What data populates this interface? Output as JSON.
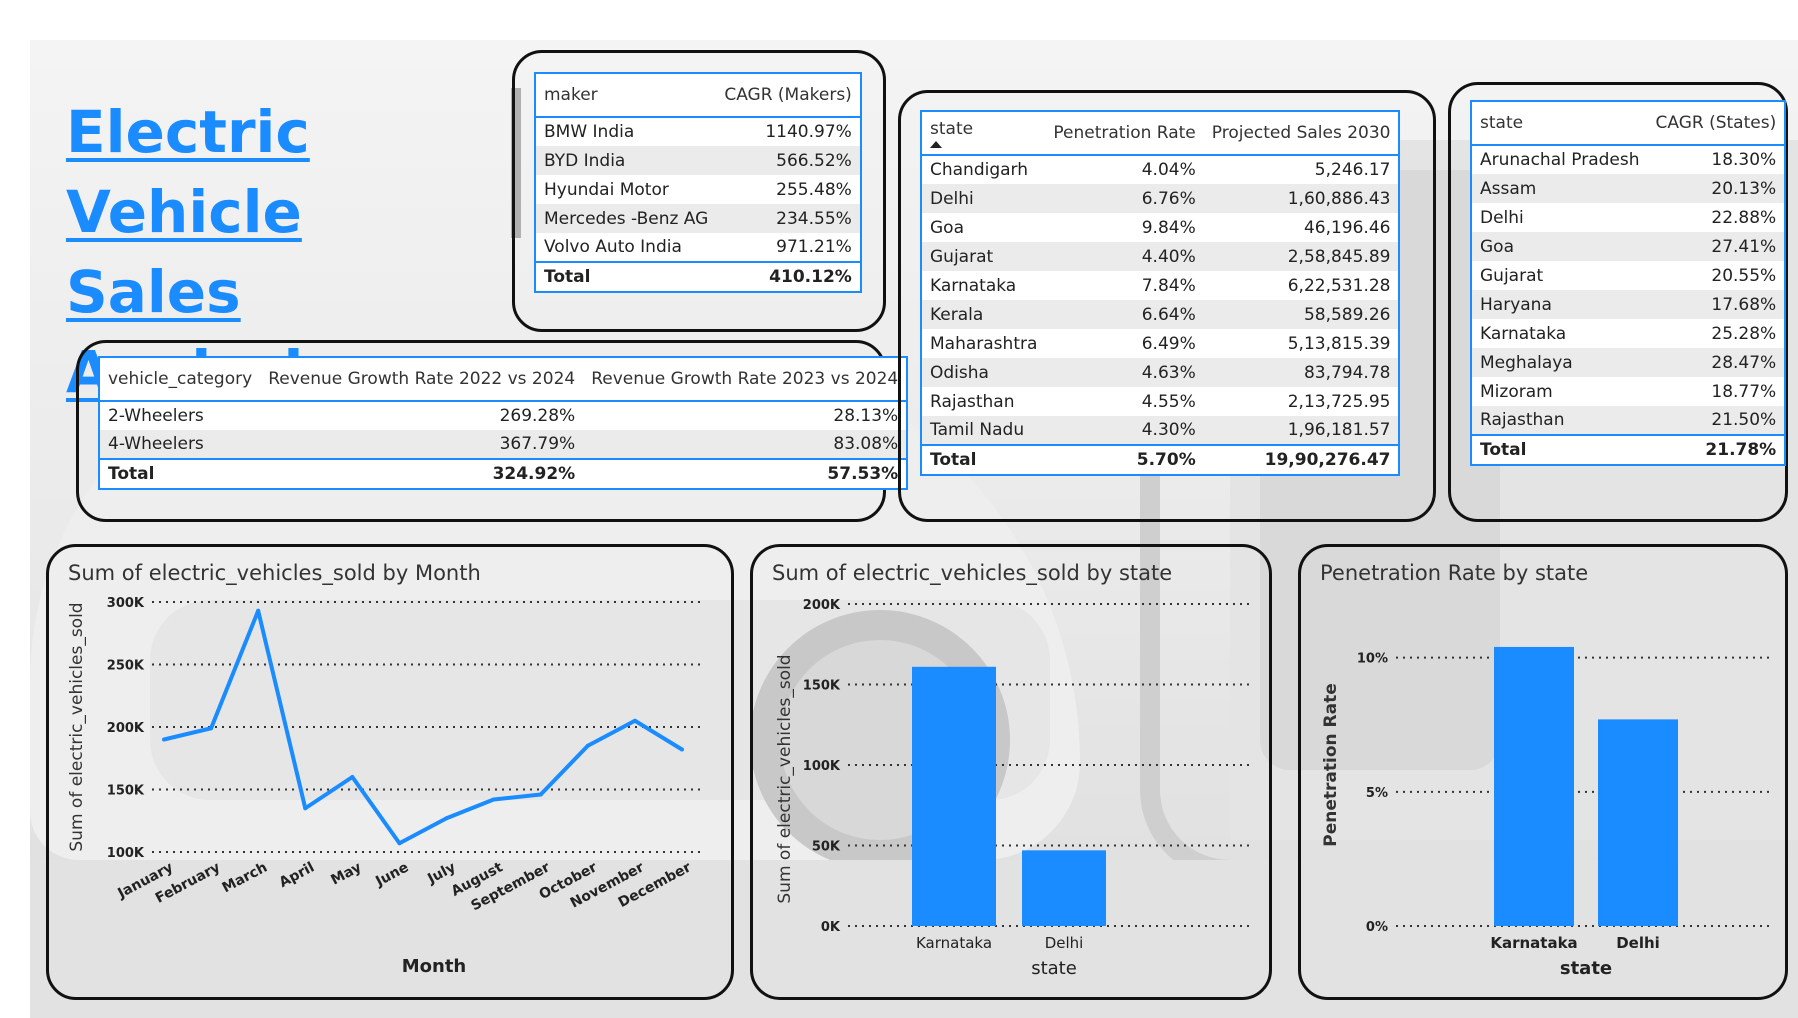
{
  "page": {
    "title_line1": "Electric Vehicle ",
    "title_line2": "Sales Analysis:",
    "accent_color": "#1a8cff"
  },
  "makers_table": {
    "headers": [
      "maker",
      "CAGR (Makers)"
    ],
    "rows": [
      [
        "BMW India",
        "1140.97%"
      ],
      [
        "BYD India",
        "566.52%"
      ],
      [
        "Hyundai Motor",
        "255.48%"
      ],
      [
        "Mercedes -Benz AG",
        "234.55%"
      ],
      [
        "Volvo Auto India",
        "971.21%"
      ]
    ],
    "total": [
      "Total",
      "410.12%"
    ]
  },
  "revenue_table": {
    "headers": [
      "vehicle_category",
      "Revenue Growth Rate 2022 vs 2024",
      "Revenue Growth Rate 2023 vs 2024"
    ],
    "rows": [
      [
        "2-Wheelers",
        "269.28%",
        "28.13%"
      ],
      [
        "4-Wheelers",
        "367.79%",
        "83.08%"
      ]
    ],
    "total": [
      "Total",
      "324.92%",
      "57.53%"
    ]
  },
  "state_projection_table": {
    "headers": [
      "state",
      "Penetration Rate",
      "Projected Sales 2030"
    ],
    "sort_icon": "sort-ascending-icon",
    "rows": [
      [
        "Chandigarh",
        "4.04%",
        "5,246.17"
      ],
      [
        "Delhi",
        "6.76%",
        "1,60,886.43"
      ],
      [
        "Goa",
        "9.84%",
        "46,196.46"
      ],
      [
        "Gujarat",
        "4.40%",
        "2,58,845.89"
      ],
      [
        "Karnataka",
        "7.84%",
        "6,22,531.28"
      ],
      [
        "Kerala",
        "6.64%",
        "58,589.26"
      ],
      [
        "Maharashtra",
        "6.49%",
        "5,13,815.39"
      ],
      [
        "Odisha",
        "4.63%",
        "83,794.78"
      ],
      [
        "Rajasthan",
        "4.55%",
        "2,13,725.95"
      ],
      [
        "Tamil Nadu",
        "4.30%",
        "1,96,181.57"
      ]
    ],
    "total": [
      "Total",
      "5.70%",
      "19,90,276.47"
    ]
  },
  "state_cagr_table": {
    "headers": [
      "state",
      "CAGR (States)"
    ],
    "rows": [
      [
        "Arunachal Pradesh",
        "18.30%"
      ],
      [
        "Assam",
        "20.13%"
      ],
      [
        "Delhi",
        "22.88%"
      ],
      [
        "Goa",
        "27.41%"
      ],
      [
        "Gujarat",
        "20.55%"
      ],
      [
        "Haryana",
        "17.68%"
      ],
      [
        "Karnataka",
        "25.28%"
      ],
      [
        "Meghalaya",
        "28.47%"
      ],
      [
        "Mizoram",
        "18.77%"
      ],
      [
        "Rajasthan",
        "21.50%"
      ]
    ],
    "total": [
      "Total",
      "21.78%"
    ]
  },
  "chart_data": [
    {
      "type": "line",
      "title": "Sum of electric_vehicles_sold by Month",
      "xlabel": "Month",
      "ylabel": "Sum of electric_vehicles_sold",
      "categories": [
        "January",
        "February",
        "March",
        "April",
        "May",
        "June",
        "July",
        "August",
        "September",
        "October",
        "November",
        "December"
      ],
      "values": [
        190000,
        199000,
        293000,
        135000,
        160000,
        107000,
        127000,
        142000,
        146000,
        185000,
        205000,
        182000
      ],
      "ylim": [
        100000,
        300000
      ],
      "yticks": [
        100000,
        150000,
        200000,
        250000,
        300000
      ],
      "ytick_labels": [
        "100K",
        "150K",
        "200K",
        "250K",
        "300K"
      ],
      "grid": true,
      "color": "#1a8cff"
    },
    {
      "type": "bar",
      "title": "Sum of electric_vehicles_sold by state",
      "xlabel": "state",
      "ylabel": "Sum of electric_vehicles_sold",
      "categories": [
        "Karnataka",
        "Delhi"
      ],
      "values": [
        161000,
        47000
      ],
      "ylim": [
        0,
        200000
      ],
      "yticks": [
        0,
        50000,
        100000,
        150000,
        200000
      ],
      "ytick_labels": [
        "0K",
        "50K",
        "100K",
        "150K",
        "200K"
      ],
      "grid": true,
      "color": "#1a8cff"
    },
    {
      "type": "bar",
      "title": "Penetration Rate by state",
      "xlabel": "state",
      "ylabel": "Penetration Rate",
      "categories": [
        "Karnataka",
        "Delhi"
      ],
      "values": [
        10.4,
        7.7
      ],
      "ylim": [
        0,
        12
      ],
      "yticks": [
        0,
        5,
        10
      ],
      "ytick_labels": [
        "0%",
        "5%",
        "10%"
      ],
      "grid": true,
      "color": "#1a8cff"
    }
  ]
}
